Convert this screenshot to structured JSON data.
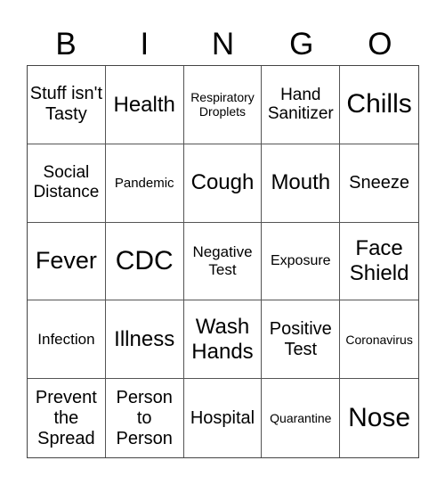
{
  "header": [
    "B",
    "I",
    "N",
    "G",
    "O"
  ],
  "cells": [
    "Stuff isn't Tasty",
    "Health",
    "Respiratory Droplets",
    "Hand Sanitizer",
    "Chills",
    "Social Distance",
    "Pandemic",
    "Cough",
    "Mouth",
    "Sneeze",
    "Fever",
    "CDC",
    "Negative Test",
    "Exposure",
    "Face Shield",
    "Infection",
    "Illness",
    "Wash Hands",
    "Positive Test",
    "Coronavirus",
    "Prevent the Spread",
    "Person to Person",
    "Hospital",
    "Quarantine",
    "Nose"
  ]
}
